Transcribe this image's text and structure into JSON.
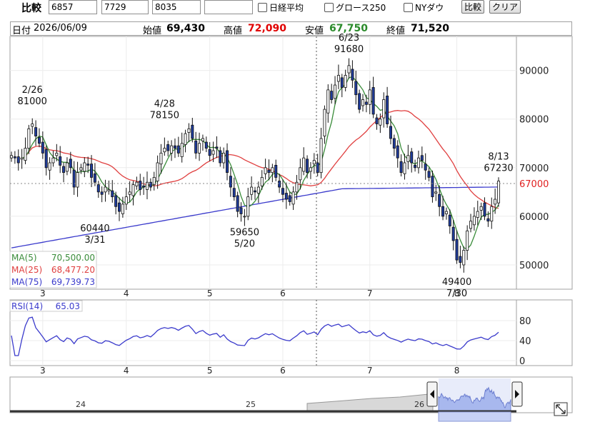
{
  "toolbar": {
    "label": "比較",
    "inputs": [
      "6857",
      "7729",
      "8035",
      ""
    ],
    "checkboxes": [
      "日経平均",
      "グロース250",
      "NYダウ"
    ],
    "compare_button": "比較",
    "clear_button": "クリア"
  },
  "info": {
    "date_label": "日付",
    "date": "2026/06/09",
    "open_label": "始値",
    "open": "69,430",
    "high_label": "高値",
    "high": "72,090",
    "low_label": "安値",
    "low": "67,750",
    "close_label": "終値",
    "close": "71,520"
  },
  "colors": {
    "up": "#ffffff",
    "down": "#1f3c9c",
    "ma5": "#3a8c3a",
    "ma25": "#e04040",
    "ma75": "#3b3bcc",
    "high": "#e00000",
    "low": "#2a8a2a",
    "navigator_fill": "#a8b8ee"
  },
  "chart_data": [
    {
      "type": "candlestick",
      "y_ticks": [
        "90000",
        "80000",
        "70000",
        "60000",
        "50000"
      ],
      "ylim": [
        45000,
        97000
      ],
      "x_ticks": [
        "3",
        "4",
        "5",
        "6",
        "7",
        "8"
      ],
      "current_price_label": "67000",
      "legend": [
        {
          "name": "MA(5)",
          "value": "70,500.00"
        },
        {
          "name": "MA(25)",
          "value": "68,477.20"
        },
        {
          "name": "MA(75)",
          "value": "69,739.73"
        }
      ],
      "annotations": [
        {
          "date": "2/26",
          "value": "81000"
        },
        {
          "date": "3/31",
          "value": "60440"
        },
        {
          "date": "4/28",
          "value": "78150"
        },
        {
          "date": "5/20",
          "value": "59650"
        },
        {
          "date": "6/23",
          "value": "91680"
        },
        {
          "date": "7/30",
          "value": "49400"
        },
        {
          "date": "8/13",
          "value": "67230"
        }
      ],
      "closes": [
        72500,
        72000,
        71000,
        72000,
        74000,
        78000,
        79000,
        76500,
        75000,
        73000,
        70000,
        71000,
        72000,
        73000,
        70500,
        69000,
        71000,
        70000,
        66000,
        69000,
        70000,
        71000,
        70500,
        68000,
        67000,
        65000,
        64500,
        66000,
        65500,
        64000,
        62000,
        61000,
        62500,
        64000,
        65000,
        66500,
        67000,
        65500,
        66000,
        67000,
        66000,
        68000,
        71000,
        73000,
        74000,
        73500,
        74500,
        74000,
        73000,
        75000,
        77000,
        78000,
        76000,
        73000,
        75000,
        76000,
        74000,
        72500,
        73500,
        74000,
        71000,
        73000,
        69000,
        66000,
        64000,
        61000,
        60500,
        60000,
        64000,
        66000,
        65000,
        66000,
        68000,
        70000,
        69000,
        70000,
        68000,
        66000,
        64500,
        63500,
        63000,
        65000,
        67000,
        70000,
        72000,
        69000,
        70000,
        71500,
        69000,
        76000,
        82000,
        86000,
        84000,
        87000,
        89000,
        86500,
        89000,
        91000,
        88000,
        85000,
        82000,
        84000,
        83000,
        86000,
        81000,
        79000,
        80000,
        84000,
        79000,
        76000,
        74000,
        72000,
        69000,
        71000,
        72500,
        71000,
        70000,
        72000,
        71500,
        69500,
        68000,
        64000,
        65000,
        62000,
        60000,
        61000,
        58000,
        55000,
        51000,
        50500,
        53000,
        57000,
        59000,
        60000,
        61000,
        62000,
        60000,
        59000,
        62000,
        63500,
        67230
      ],
      "rsi": {
        "label": "RSI(14)",
        "value": "65.03",
        "y_ticks": [
          "80",
          "40",
          "0"
        ],
        "ylim": [
          0,
          100
        ]
      }
    }
  ],
  "navigator": {
    "labels": [
      "24",
      "25",
      "26"
    ]
  }
}
